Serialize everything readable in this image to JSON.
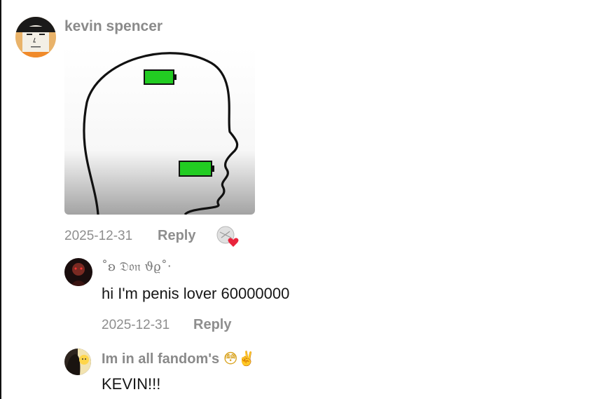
{
  "comment": {
    "username": "kevin spencer",
    "date": "2025-12-31",
    "reply_label": "Reply",
    "image_icons": [
      "head-profile-outline",
      "battery-icon",
      "battery-icon"
    ]
  },
  "replies": [
    {
      "username": "˚ʚ 𝔇𝔬𝔫 ϑϱ˚‧",
      "text": "hi I'm penis lover 60000000",
      "date": "2025-12-31",
      "reply_label": "Reply"
    },
    {
      "username": "Im in all fandom's",
      "emojis": "😳✌️",
      "text": "KEVIN!!!"
    }
  ],
  "colors": {
    "battery_green": "#22cc22",
    "like_heart": "#e8243c",
    "meta_gray": "#8e8e8e"
  }
}
